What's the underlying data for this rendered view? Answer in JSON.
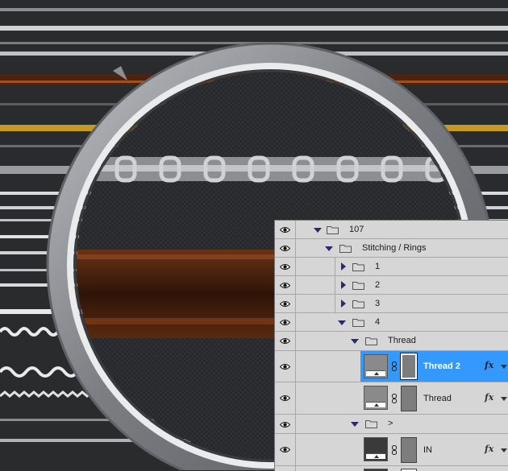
{
  "layers_panel": {
    "rows": [
      {
        "type": "group",
        "label": "107",
        "expanded": true,
        "depth": 0
      },
      {
        "type": "group",
        "label": "Stitching / Rings",
        "expanded": true,
        "depth": 1
      },
      {
        "type": "group",
        "label": "1",
        "expanded": false,
        "depth": 2
      },
      {
        "type": "group",
        "label": "2",
        "expanded": false,
        "depth": 2
      },
      {
        "type": "group",
        "label": "3",
        "expanded": false,
        "depth": 2
      },
      {
        "type": "group",
        "label": "4",
        "expanded": true,
        "depth": 2
      },
      {
        "type": "group",
        "label": "Thread",
        "expanded": true,
        "depth": 3
      },
      {
        "type": "layer",
        "label": "Thread 2",
        "selected": true,
        "fx": "fx"
      },
      {
        "type": "layer",
        "label": "Thread",
        "selected": false,
        "fx": "fx"
      },
      {
        "type": "group",
        "label": ">",
        "expanded": true,
        "depth": 3
      },
      {
        "type": "layer",
        "label": "IN",
        "selected": false,
        "fx": "fx"
      }
    ],
    "colors": {
      "selected_row": "#3399ff",
      "panel_bg": "#d6d6d6",
      "separator": "#a8a8a8"
    }
  },
  "icons": {
    "visibility": "eye-icon",
    "group": "folder-icon",
    "expand": "disclosure-triangle-icon",
    "link": "chain-link-icon",
    "effects": "fx-icon"
  }
}
